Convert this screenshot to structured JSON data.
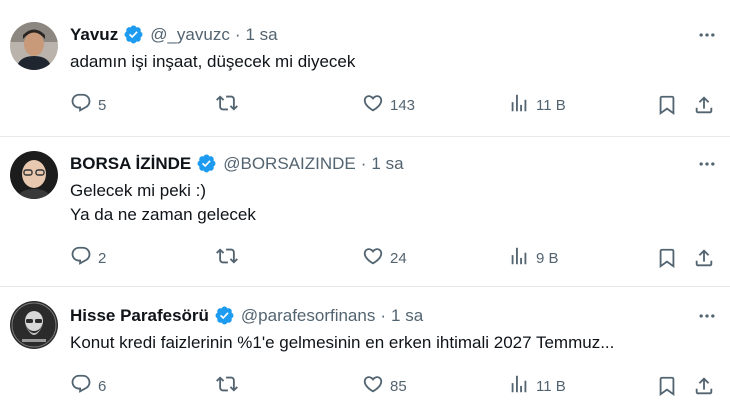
{
  "colors": {
    "verified": "#1d9bf0",
    "text": "#0f1419",
    "muted": "#536471",
    "divider": "#e6e9ec"
  },
  "tweets": [
    {
      "name": "Yavuz",
      "handle": "@_yavuzc",
      "separator": "·",
      "time": "1 sa",
      "lines": [
        "adamın işi inşaat, düşecek mi diyecek"
      ],
      "replies": "5",
      "retweets": "",
      "likes": "143",
      "views": "11 B"
    },
    {
      "name": "BORSA İZİNDE",
      "handle": "@BORSAIZINDE",
      "separator": "·",
      "time": "1 sa",
      "lines": [
        "Gelecek mi peki :)",
        "Ya da ne zaman gelecek"
      ],
      "replies": "2",
      "retweets": "",
      "likes": "24",
      "views": "9 B"
    },
    {
      "name": "Hisse Parafesörü",
      "handle": "@parafesorfinans",
      "separator": "·",
      "time": "1 sa",
      "lines": [
        "Konut kredi faizlerinin %1'e gelmesinin en erken ihtimali 2027 Temmuz..."
      ],
      "replies": "6",
      "retweets": "",
      "likes": "85",
      "views": "11 B"
    }
  ]
}
